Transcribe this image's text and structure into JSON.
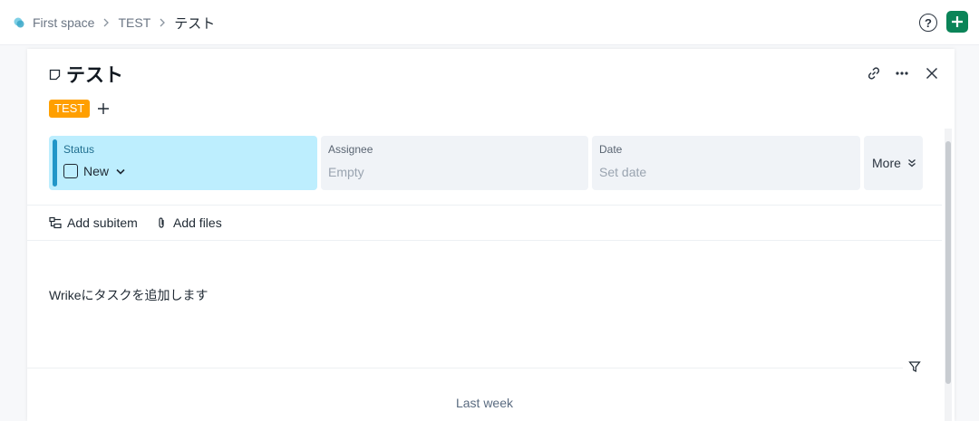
{
  "breadcrumb": {
    "items": [
      "First space",
      "TEST",
      "テスト"
    ]
  },
  "header": {
    "help_label": "?",
    "add_icon": "plus-icon"
  },
  "task": {
    "title": "テスト",
    "tag": "TEST",
    "fields": {
      "status_label": "Status",
      "status_value": "New",
      "assignee_label": "Assignee",
      "assignee_placeholder": "Empty",
      "date_label": "Date",
      "date_placeholder": "Set date",
      "more_label": "More"
    },
    "actions": {
      "add_subitem": "Add subitem",
      "add_files": "Add files"
    },
    "description": "Wrikeにタスクを追加します",
    "stream_label": "Last week"
  },
  "colors": {
    "brand_green": "#0b8458",
    "tag_orange": "#ff9f00",
    "status_bg": "#bdeefe",
    "status_accent": "#2196c8"
  }
}
